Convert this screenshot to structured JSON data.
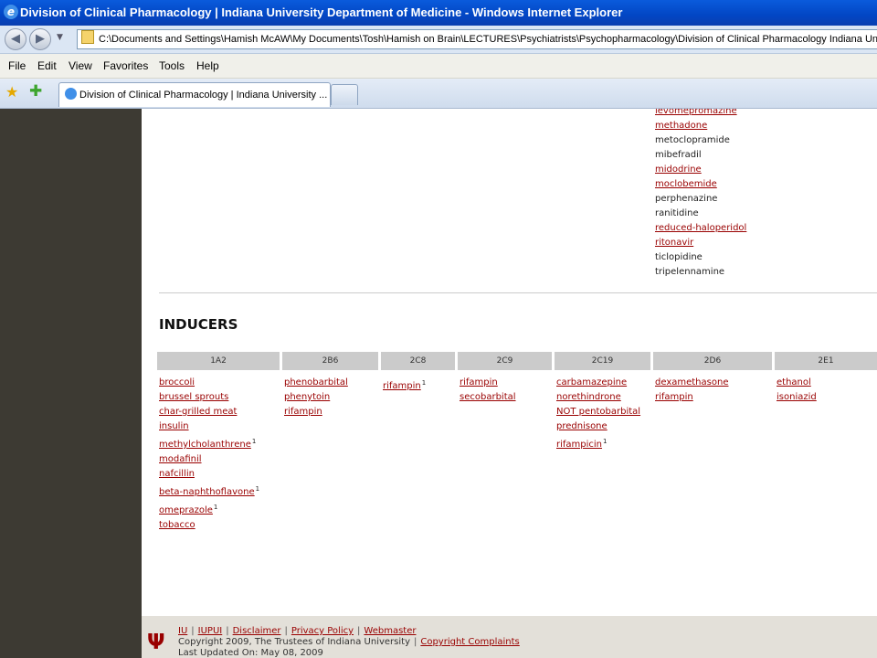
{
  "window": {
    "title": "Division of Clinical Pharmacology | Indiana University Department of Medicine - Windows Internet Explorer"
  },
  "address": {
    "value": "C:\\Documents and Settings\\Hamish McAW\\My Documents\\Tosh\\Hamish on Brain\\LECTURES\\Psychiatrists\\Psychopharmacology\\Division of Clinical Pharmacology  Indiana University"
  },
  "menu": [
    "File",
    "Edit",
    "View",
    "Favorites",
    "Tools",
    "Help"
  ],
  "tab": {
    "label": "Division of Clinical Pharmacology | Indiana University ..."
  },
  "inhibitor_tail": [
    {
      "name": "levomepromazine",
      "link": true
    },
    {
      "name": "methadone",
      "link": true
    },
    {
      "name": "metoclopramide",
      "link": false
    },
    {
      "name": "mibefradil",
      "link": false
    },
    {
      "name": "midodrine",
      "link": true
    },
    {
      "name": "moclobemide",
      "link": true
    },
    {
      "name": "perphenazine",
      "link": false
    },
    {
      "name": "ranitidine",
      "link": false
    },
    {
      "name": "reduced-haloperidol",
      "link": true
    },
    {
      "name": "ritonavir",
      "link": true
    },
    {
      "name": "ticlopidine",
      "link": false
    },
    {
      "name": "tripelennamine",
      "link": false
    }
  ],
  "inducers": {
    "heading": "INDUCERS",
    "columns": [
      {
        "header": "1A2",
        "drugs": [
          {
            "name": "broccoli"
          },
          {
            "name": "brussel sprouts"
          },
          {
            "name": "char-grilled meat"
          },
          {
            "name": "insulin"
          },
          {
            "name": "methylcholanthrene",
            "sup": "1"
          },
          {
            "name": "modafinil"
          },
          {
            "name": "nafcillin"
          },
          {
            "name": "beta-naphthoflavone",
            "sup": "1"
          },
          {
            "name": "omeprazole",
            "sup": "1"
          },
          {
            "name": "tobacco"
          }
        ]
      },
      {
        "header": "2B6",
        "drugs": [
          {
            "name": "phenobarbital"
          },
          {
            "name": "phenytoin"
          },
          {
            "name": "rifampin"
          }
        ]
      },
      {
        "header": "2C8",
        "drugs": [
          {
            "name": "rifampin",
            "sup": "1"
          }
        ]
      },
      {
        "header": "2C9",
        "drugs": [
          {
            "name": "rifampin"
          },
          {
            "name": "secobarbital"
          }
        ]
      },
      {
        "header": "2C19",
        "drugs": [
          {
            "name": "carbamazepine"
          },
          {
            "name": "norethindrone"
          },
          {
            "name": "NOT pentobarbital"
          },
          {
            "name": "prednisone"
          },
          {
            "name": "rifampicin",
            "sup": "1"
          }
        ]
      },
      {
        "header": "2D6",
        "drugs": [
          {
            "name": "dexamethasone"
          },
          {
            "name": "rifampin"
          }
        ]
      },
      {
        "header": "2E1",
        "drugs": [
          {
            "name": "ethanol"
          },
          {
            "name": "isoniazid"
          }
        ]
      }
    ]
  },
  "footer": {
    "links": [
      "IU",
      "IUPUI",
      "Disclaimer",
      "Privacy Policy",
      "Webmaster"
    ],
    "copyright": "Copyright 2009, The Trustees of Indiana University",
    "complaints": "Copyright Complaints",
    "updated": "Last Updated On: May 08, 2009"
  }
}
